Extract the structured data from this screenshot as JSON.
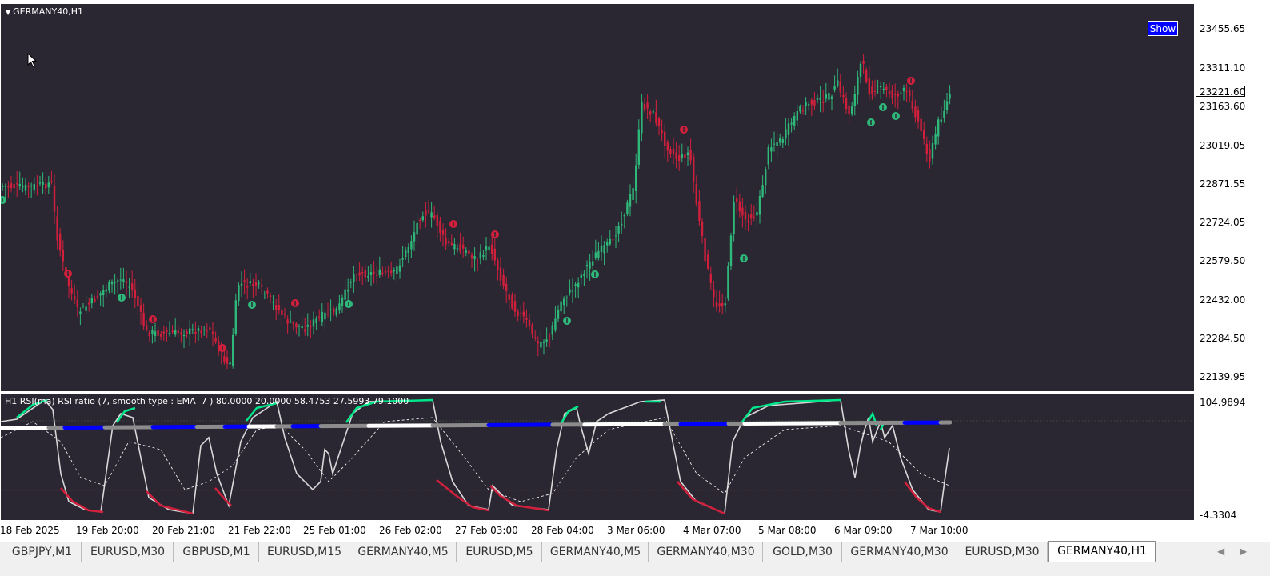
{
  "chart": {
    "symbol_title": "GERMANY40,H1",
    "show_button": "Show",
    "price_labels": [
      "23455.65",
      "23311.10",
      "23163.60",
      "23019.05",
      "22871.55",
      "22724.05",
      "22579.50",
      "22432.00",
      "22284.50",
      "22139.95"
    ],
    "current_price": "23221.60",
    "colors": {
      "background": "#2b2732",
      "bull": "#2eb87a",
      "bear": "#d21f3c"
    }
  },
  "indicator": {
    "title": "H1 RSI(ma) RSI ratio (7, smooth type : EMA  7 ) 80.0000 20.0000 58.4753 27.5993 79.1000",
    "top_label": "104.9894",
    "bottom_label": "-4.3304",
    "colors": {
      "up": "#00e68a",
      "down": "#d21f3c",
      "neutral_line": "#e0e0e0",
      "blue": "#0000ff",
      "gray": "#8c8c8c"
    }
  },
  "time_labels": [
    "18 Feb 2025",
    "19 Feb 20:00",
    "20 Feb 21:00",
    "21 Feb 22:00",
    "25 Feb 01:00",
    "26 Feb 02:00",
    "27 Feb 03:00",
    "28 Feb 04:00",
    "3 Mar 06:00",
    "4 Mar 07:00",
    "5 Mar 08:00",
    "6 Mar 09:00",
    "7 Mar 10:00"
  ],
  "tabs": [
    "GBPJPY,M1",
    "EURUSD,M30",
    "GBPUSD,M1",
    "EURUSD,M15",
    "GERMANY40,M5",
    "EURUSD,M5",
    "GERMANY40,M5",
    "GERMANY40,M30",
    "GOLD,M30",
    "GERMANY40,M30",
    "EURUSD,M30",
    "GERMANY40,H1"
  ],
  "active_tab": "GERMANY40,H1",
  "icons": {
    "tab_left": "triangle-left-icon",
    "tab_right": "triangle-right-icon",
    "cursor": "mouse-pointer-icon"
  }
}
